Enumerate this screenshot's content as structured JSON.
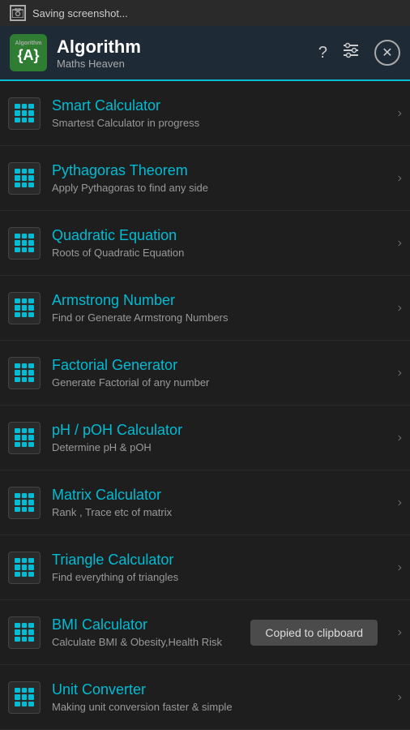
{
  "statusBar": {
    "text": "Saving screenshot..."
  },
  "header": {
    "logoLine1": "{A}",
    "title": "Algorithm",
    "subtitle": "Maths Heaven",
    "helpIcon": "?",
    "settingsIcon": "⇅",
    "closeIcon": "✕"
  },
  "items": [
    {
      "id": "smart-calculator",
      "title": "Smart Calculator",
      "subtitle": "Smartest Calculator in progress",
      "arrow": "›"
    },
    {
      "id": "pythagoras-theorem",
      "title": "Pythagoras Theorem",
      "subtitle": "Apply Pythagoras to find any side",
      "arrow": "›"
    },
    {
      "id": "quadratic-equation",
      "title": "Quadratic Equation",
      "subtitle": "Roots of Quadratic Equation",
      "arrow": "›"
    },
    {
      "id": "armstrong-number",
      "title": "Armstrong Number",
      "subtitle": "Find or Generate Armstrong Numbers",
      "arrow": "›"
    },
    {
      "id": "factorial-generator",
      "title": "Factorial Generator",
      "subtitle": "Generate Factorial of any number",
      "arrow": "›"
    },
    {
      "id": "ph-poh-calculator",
      "title": "pH / pOH Calculator",
      "subtitle": "Determine pH & pOH",
      "arrow": "›"
    },
    {
      "id": "matrix-calculator",
      "title": "Matrix Calculator",
      "subtitle": "Rank , Trace etc of matrix",
      "arrow": "›"
    },
    {
      "id": "triangle-calculator",
      "title": "Triangle Calculator",
      "subtitle": "Find everything of triangles",
      "arrow": "›"
    },
    {
      "id": "bmi-calculator",
      "title": "BMI Calculator",
      "subtitle": "Calculate BMI & Obesity,Health Risk",
      "arrow": "›",
      "showToast": true,
      "toastText": "Copied to clipboard"
    },
    {
      "id": "unit-converter",
      "title": "Unit Converter",
      "subtitle": "Making unit conversion faster & simple",
      "arrow": "›"
    }
  ]
}
